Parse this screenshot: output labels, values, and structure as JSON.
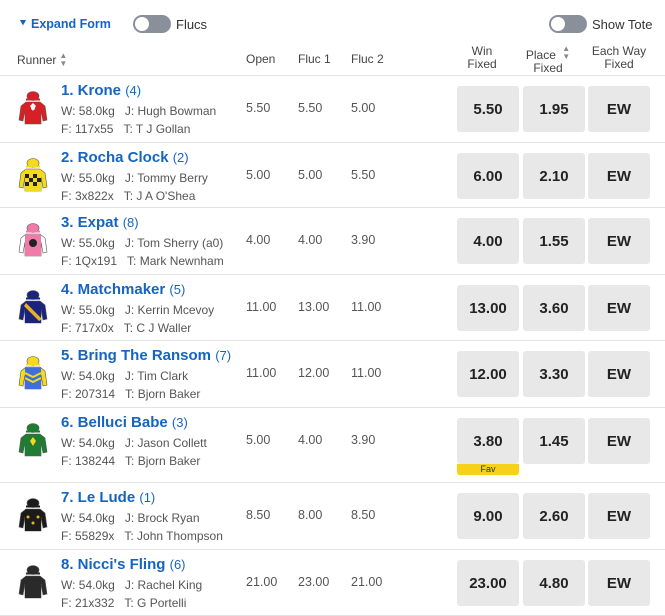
{
  "top": {
    "expand_label": "Expand Form",
    "flucs_label": "Flucs",
    "tote_label": "Show Tote"
  },
  "header": {
    "runner": "Runner",
    "open": "Open",
    "fluc1": "Fluc 1",
    "fluc2": "Fluc 2",
    "win_1": "Win",
    "win_2": "Fixed",
    "place_1": "Place",
    "place_2": "Fixed",
    "ew_1": "Each Way",
    "ew_2": "Fixed"
  },
  "colors": {
    "accent": "#1565c0",
    "button_bg": "#e8e8e8",
    "fav_badge": "#f7d117",
    "toggle_off": "#8a9099"
  },
  "runners": [
    {
      "name": "1. Krone",
      "barrier": "(4)",
      "weight": "W: 58.0kg",
      "jockey": "J: Hugh Bowman",
      "form": "F: 117x55",
      "trainer": "T: T J Gollan",
      "open": "5.50",
      "fluc1": "5.50",
      "fluc2": "5.00",
      "win": "5.50",
      "place": "1.95",
      "ew": "EW",
      "fav": "",
      "silk": "red-white-emblem"
    },
    {
      "name": "2. Rocha Clock",
      "barrier": "(2)",
      "weight": "W: 55.0kg",
      "jockey": "J: Tommy Berry",
      "form": "F: 3x822x",
      "trainer": "T: J A O'Shea",
      "open": "5.00",
      "fluc1": "5.00",
      "fluc2": "5.50",
      "win": "6.00",
      "place": "2.10",
      "ew": "EW",
      "fav": "",
      "silk": "yellow-black-checks"
    },
    {
      "name": "3. Expat",
      "barrier": "(8)",
      "weight": "W: 55.0kg",
      "jockey": "J: Tom Sherry (a0)",
      "form": "F: 1Qx191",
      "trainer": "T: Mark Newnham",
      "open": "4.00",
      "fluc1": "4.00",
      "fluc2": "3.90",
      "win": "4.00",
      "place": "1.55",
      "ew": "EW",
      "fav": "",
      "silk": "pink-black-white"
    },
    {
      "name": "4. Matchmaker",
      "barrier": "(5)",
      "weight": "W: 55.0kg",
      "jockey": "J: Kerrin Mcevoy",
      "form": "F: 717x0x",
      "trainer": "T: C J Waller",
      "open": "11.00",
      "fluc1": "13.00",
      "fluc2": "11.00",
      "win": "13.00",
      "place": "3.60",
      "ew": "EW",
      "fav": "",
      "silk": "navy-gold-sash"
    },
    {
      "name": "5. Bring The Ransom",
      "barrier": "(7)",
      "weight": "W: 54.0kg",
      "jockey": "J: Tim Clark",
      "form": "F: 207314",
      "trainer": "T: Bjorn Baker",
      "open": "11.00",
      "fluc1": "12.00",
      "fluc2": "11.00",
      "win": "12.00",
      "place": "3.30",
      "ew": "EW",
      "fav": "",
      "silk": "blue-yellow-chevrons"
    },
    {
      "name": "6. Belluci Babe",
      "barrier": "(3)",
      "weight": "W: 54.0kg",
      "jockey": "J: Jason Collett",
      "form": "F: 138244",
      "trainer": "T: Bjorn Baker",
      "open": "5.00",
      "fluc1": "4.00",
      "fluc2": "3.90",
      "win": "3.80",
      "place": "1.45",
      "ew": "EW",
      "fav": "Fav",
      "silk": "green-yellow-emblem"
    },
    {
      "name": "7. Le Lude",
      "barrier": "(1)",
      "weight": "W: 54.0kg",
      "jockey": "J: Brock Ryan",
      "form": "F: 55829x",
      "trainer": "T: John Thompson",
      "open": "8.50",
      "fluc1": "8.00",
      "fluc2": "8.50",
      "win": "9.00",
      "place": "2.60",
      "ew": "EW",
      "fav": "",
      "silk": "black-gold-stars"
    },
    {
      "name": "8. Nicci's Fling",
      "barrier": "(6)",
      "weight": "W: 54.0kg",
      "jockey": "J: Rachel King",
      "form": "F: 21x332",
      "trainer": "T: G Portelli",
      "open": "21.00",
      "fluc1": "23.00",
      "fluc2": "21.00",
      "win": "23.00",
      "place": "4.80",
      "ew": "EW",
      "fav": "",
      "silk": "black-plain"
    }
  ]
}
